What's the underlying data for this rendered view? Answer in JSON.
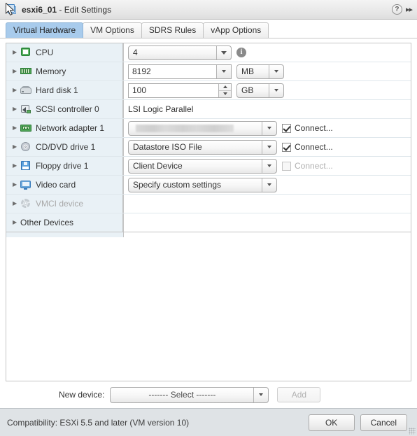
{
  "titlebar": {
    "vm_name": "esxi6_01",
    "separator": " - ",
    "title_suffix": "Edit Settings",
    "help_label": "?",
    "collapse_label": "▸▸"
  },
  "tabs": [
    {
      "label": "Virtual Hardware",
      "active": true
    },
    {
      "label": "VM Options",
      "active": false
    },
    {
      "label": "SDRS Rules",
      "active": false
    },
    {
      "label": "vApp Options",
      "active": false
    }
  ],
  "devices": [
    {
      "name": "CPU",
      "icon": "cpu-icon",
      "value": "4",
      "control": "combo",
      "unit": null,
      "info": true,
      "connect": null,
      "disabled": false
    },
    {
      "name": "Memory",
      "icon": "memory-icon",
      "value": "8192",
      "control": "textfield-dropdown",
      "unit": "MB",
      "info": false,
      "connect": null,
      "disabled": false
    },
    {
      "name": "Hard disk 1",
      "icon": "harddisk-icon",
      "value": "100",
      "control": "textfield-spinner",
      "unit": "GB",
      "info": false,
      "connect": null,
      "disabled": false
    },
    {
      "name": "SCSI controller 0",
      "icon": "scsi-controller-icon",
      "value": "LSI Logic Parallel",
      "control": "text",
      "unit": null,
      "info": false,
      "connect": null,
      "disabled": false
    },
    {
      "name": "Network adapter 1",
      "icon": "network-adapter-icon",
      "value": "",
      "control": "combo-redacted",
      "unit": null,
      "info": false,
      "connect": {
        "label": "Connect...",
        "checked": true,
        "disabled": false
      },
      "disabled": false
    },
    {
      "name": "CD/DVD drive 1",
      "icon": "cddvd-icon",
      "value": "Datastore ISO File",
      "control": "combo",
      "unit": null,
      "info": false,
      "connect": {
        "label": "Connect...",
        "checked": true,
        "disabled": false
      },
      "disabled": false
    },
    {
      "name": "Floppy drive 1",
      "icon": "floppy-icon",
      "value": "Client Device",
      "control": "combo",
      "unit": null,
      "info": false,
      "connect": {
        "label": "Connect...",
        "checked": false,
        "disabled": true
      },
      "disabled": false
    },
    {
      "name": "Video card",
      "icon": "video-card-icon",
      "value": "Specify custom settings",
      "control": "combo",
      "unit": null,
      "info": false,
      "connect": null,
      "disabled": false
    },
    {
      "name": "VMCI device",
      "icon": "vmci-icon",
      "value": "",
      "control": "none",
      "unit": null,
      "info": false,
      "connect": null,
      "disabled": true
    },
    {
      "name": "Other Devices",
      "icon": null,
      "value": "",
      "control": "none",
      "unit": null,
      "info": false,
      "connect": null,
      "disabled": false
    }
  ],
  "new_device": {
    "label": "New device:",
    "selected": "------- Select -------",
    "add_label": "Add",
    "add_disabled": true
  },
  "footer": {
    "compatibility": "Compatibility: ESXi 5.5 and later (VM version 10)",
    "ok_label": "OK",
    "cancel_label": "Cancel"
  },
  "colors": {
    "active_tab": "#a8cbec",
    "name_column": "#e9f1f6",
    "footer_bar": "#dfe3e6"
  }
}
